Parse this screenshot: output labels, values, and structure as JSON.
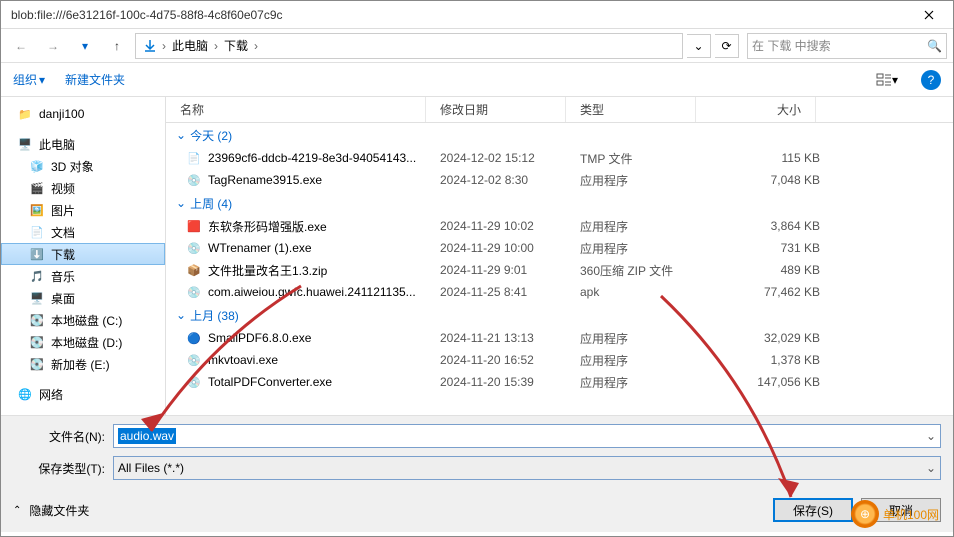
{
  "titlebar": {
    "title": "blob:file:///6e31216f-100c-4d75-88f8-4c8f60e07c9c"
  },
  "breadcrumb": {
    "root": "此电脑",
    "current": "下载"
  },
  "search": {
    "placeholder": "在 下载 中搜索"
  },
  "toolbar": {
    "organize": "组织",
    "new_folder": "新建文件夹"
  },
  "nav": {
    "danji": "danji100",
    "this_pc": "此电脑",
    "3d": "3D 对象",
    "video": "视频",
    "pictures": "图片",
    "documents": "文档",
    "downloads": "下载",
    "music": "音乐",
    "desktop": "桌面",
    "disk_c": "本地磁盘 (C:)",
    "disk_d": "本地磁盘 (D:)",
    "disk_e": "新加卷 (E:)",
    "network": "网络"
  },
  "cols": {
    "name": "名称",
    "date": "修改日期",
    "type": "类型",
    "size": "大小"
  },
  "groups": {
    "today": {
      "label": "今天 (2)",
      "items": [
        {
          "icon": "📄",
          "name": "23969cf6-ddcb-4219-8e3d-94054143...",
          "date": "2024-12-02 15:12",
          "type": "TMP 文件",
          "size": "115 KB"
        },
        {
          "icon": "💿",
          "name": "TagRename3915.exe",
          "date": "2024-12-02 8:30",
          "type": "应用程序",
          "size": "7,048 KB"
        }
      ]
    },
    "last_week": {
      "label": "上周 (4)",
      "items": [
        {
          "icon": "🟥",
          "name": "东软条形码增强版.exe",
          "date": "2024-11-29 10:02",
          "type": "应用程序",
          "size": "3,864 KB"
        },
        {
          "icon": "💿",
          "name": "WTrenamer (1).exe",
          "date": "2024-11-29 10:00",
          "type": "应用程序",
          "size": "731 KB"
        },
        {
          "icon": "📦",
          "name": "文件批量改名王1.3.zip",
          "date": "2024-11-29 9:01",
          "type": "360压缩 ZIP 文件",
          "size": "489 KB"
        },
        {
          "icon": "💿",
          "name": "com.aiweiou.gwfc.huawei.241121135...",
          "date": "2024-11-25 8:41",
          "type": "apk",
          "size": "77,462 KB"
        }
      ]
    },
    "last_month": {
      "label": "上月 (38)",
      "items": [
        {
          "icon": "🔵",
          "name": "SmallPDF6.8.0.exe",
          "date": "2024-11-21 13:13",
          "type": "应用程序",
          "size": "32,029 KB"
        },
        {
          "icon": "💿",
          "name": "mkvtoavi.exe",
          "date": "2024-11-20 16:52",
          "type": "应用程序",
          "size": "1,378 KB"
        },
        {
          "icon": "💿",
          "name": "TotalPDFConverter.exe",
          "date": "2024-11-20 15:39",
          "type": "应用程序",
          "size": "147,056 KB"
        }
      ]
    }
  },
  "bottom": {
    "filename_label": "文件名(N):",
    "filename_value": "audio.wav",
    "filetype_label": "保存类型(T):",
    "filetype_value": "All Files (*.*)",
    "hide_folders": "隐藏文件夹",
    "save": "保存(S)",
    "cancel": "取消"
  },
  "watermark": "单机100网"
}
